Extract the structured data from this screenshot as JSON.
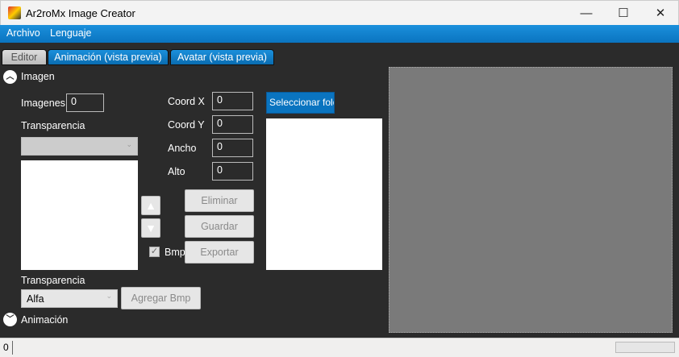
{
  "window": {
    "title": "Ar2roMx Image Creator",
    "minimize": "—",
    "maximize": "☐",
    "close": "✕"
  },
  "menu": {
    "items": [
      {
        "label": "Archivo"
      },
      {
        "label": "Lenguaje"
      }
    ]
  },
  "tabs": [
    {
      "label": "Editor"
    },
    {
      "label": "Animación (vista previa)"
    },
    {
      "label": "Avatar (vista previa)"
    }
  ],
  "imagen": {
    "section_label": "Imagen",
    "imagenes_label": "Imagenes",
    "imagenes_value": "0",
    "transparencia_label": "Transparencia",
    "coord_x_label": "Coord X",
    "coord_x": "0",
    "coord_y_label": "Coord Y",
    "coord_y": "0",
    "ancho_label": "Ancho",
    "ancho": "0",
    "alto_label": "Alto",
    "alto": "0",
    "select_folder": "Seleccionar folder",
    "eliminar": "Eliminar",
    "guardar": "Guardar",
    "exportar": "Exportar",
    "bmp_label": "Bmp",
    "bmp_checked": true,
    "transparencia2_label": "Transparencia",
    "transparencia2_value": "Alfa",
    "agregar_bmp": "Agregar Bmp"
  },
  "animacion": {
    "section_label": "Animación"
  },
  "status": {
    "value": "0"
  }
}
